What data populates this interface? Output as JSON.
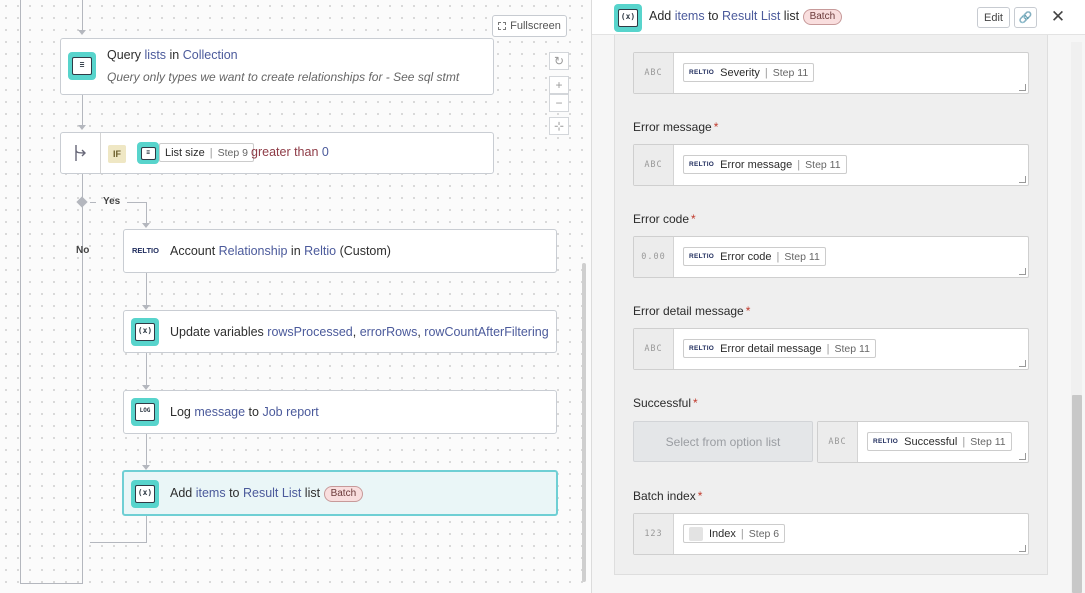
{
  "canvas": {
    "fullscreen_label": "Fullscreen",
    "query_step": {
      "prefix": "Query ",
      "object": "lists",
      "mid": " in ",
      "target": "Collection",
      "description": "Query only types we want to create relationships for - See sql stmt"
    },
    "if_step": {
      "badge": "IF",
      "pill_label": "List size",
      "pill_step": "Step 9",
      "operator": "greater than",
      "value": "0"
    },
    "yes_label": "Yes",
    "no_label": "No",
    "reltio_step": {
      "logo": "RELTIO",
      "prefix": "Account ",
      "object": "Relationship",
      "mid": " in ",
      "target": "Reltio",
      "suffix": " (Custom)"
    },
    "update_step": {
      "prefix": "Update variables ",
      "var1": "rowsProcessed",
      "var2": "errorRows",
      "var3": "rowCountAfterFiltering",
      "comma": ", "
    },
    "log_step": {
      "icon_text": "LOG",
      "prefix": "Log ",
      "object": "message",
      "mid": " to ",
      "target": "Job report"
    },
    "add_step": {
      "prefix": "Add ",
      "object": "items",
      "mid": " to ",
      "target": "Result List",
      "suffix": " list",
      "badge": "Batch"
    }
  },
  "panel": {
    "header": {
      "prefix": "Add ",
      "object": "items",
      "mid": " to ",
      "target": "Result List",
      "suffix": " list",
      "badge": "Batch",
      "edit_label": "Edit"
    },
    "fields": [
      {
        "label": "",
        "type": "ABC",
        "pill_label": "Severity",
        "pill_step": "Step 11",
        "logo": "RELTIO"
      },
      {
        "label": "Error message",
        "required": "*",
        "type": "ABC",
        "pill_label": "Error message",
        "pill_step": "Step 11",
        "logo": "RELTIO"
      },
      {
        "label": "Error code",
        "required": "*",
        "type": "0.00",
        "pill_label": "Error code",
        "pill_step": "Step 11",
        "logo": "RELTIO"
      },
      {
        "label": "Error detail message",
        "required": "*",
        "type": "ABC",
        "pill_label": "Error detail message",
        "pill_step": "Step 11",
        "logo": "RELTIO"
      },
      {
        "label": "Successful",
        "required": "*",
        "select_placeholder": "Select from option list",
        "type": "ABC",
        "pill_label": "Successful",
        "pill_step": "Step 11",
        "logo": "RELTIO"
      },
      {
        "label": "Batch index",
        "required": "*",
        "type": "123",
        "pill_label": "Index",
        "pill_step": "Step 6"
      }
    ]
  },
  "colors": {
    "accent": "#58d4cc",
    "link": "#4b5a9b",
    "operator": "#8e3b46",
    "required": "#c0392b",
    "batch_bg": "#f9dede"
  }
}
